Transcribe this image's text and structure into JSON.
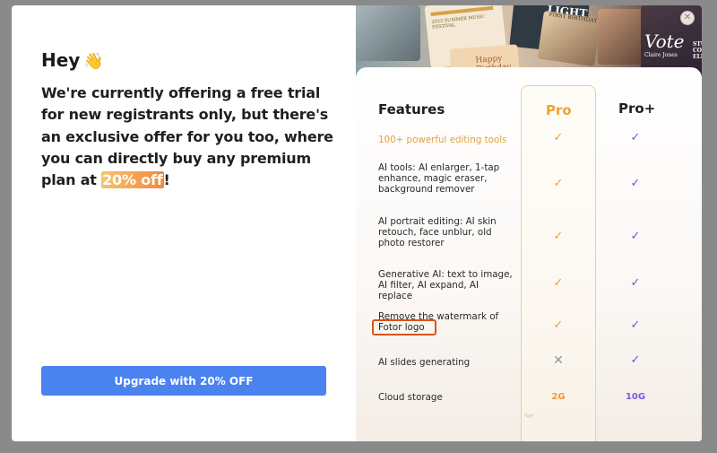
{
  "greeting": "Hey",
  "wave_icon": "👋",
  "offer": {
    "text_before": "We're currently offering a free trial for new registrants only, but there's an exclusive offer for you too, where you can directly buy any premium plan at ",
    "highlight": "20% off",
    "text_after": "!"
  },
  "upgrade_button": "Upgrade with 20% OFF",
  "banner": {
    "tile_music": "2023 SUMMER MUSIC FESTIVAL",
    "tile_light": "LIGHT",
    "tile_birthday": "Happy Birthday",
    "tile_caption": "FIRST BIRTHDAY",
    "tile_vote": "Vote",
    "tile_name": "Claire Jones",
    "tile_side": "STUDENT COUNCIL ELECTION"
  },
  "close_icon": "close-icon",
  "table": {
    "header_features": "Features",
    "header_pro": "Pro",
    "header_pro_plus": "Pro+",
    "rows": [
      {
        "feature": "100+ powerful editing tools",
        "pro": "✓",
        "pro_plus": "✓"
      },
      {
        "feature": "AI tools: AI enlarger, 1-tap enhance, magic eraser, background remover",
        "pro": "✓",
        "pro_plus": "✓"
      },
      {
        "feature": "AI portrait editing: AI skin retouch, face unblur, old photo restorer",
        "pro": "✓",
        "pro_plus": "✓"
      },
      {
        "feature": "Generative AI: text to image, AI filter, AI expand, AI replace",
        "pro": "✓",
        "pro_plus": "✓"
      },
      {
        "feature": "Remove the watermark of Fotor logo",
        "pro": "✓",
        "pro_plus": "✓"
      },
      {
        "feature": "AI slides generating",
        "pro": "✕",
        "pro_plus": "✓"
      },
      {
        "feature": "Cloud storage",
        "pro": "2G",
        "pro_plus": "10G"
      }
    ]
  },
  "colors": {
    "accent_orange": "#ec9b3a",
    "accent_purple": "#6f55d8",
    "button_blue": "#4a82f0",
    "annotation_red": "#d8541f"
  }
}
